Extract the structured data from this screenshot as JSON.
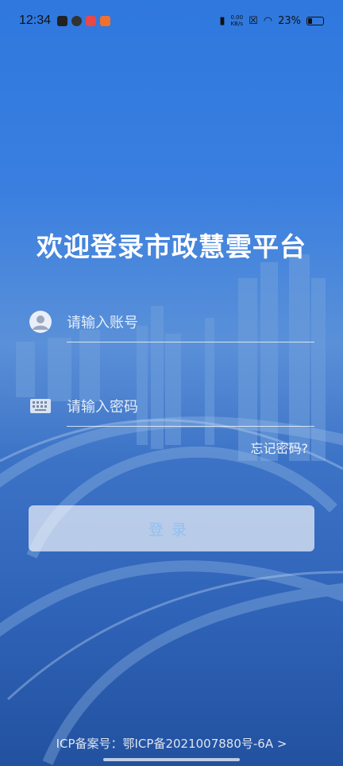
{
  "status_bar": {
    "time": "12:34",
    "net_speed_value": "0.00",
    "net_speed_unit": "KB/s",
    "battery_percent": "23%",
    "battery_level": 0.23
  },
  "app": {
    "title": "欢迎登录市政慧雲平台"
  },
  "form": {
    "account_placeholder": "请输入账号",
    "password_placeholder": "请输入密码",
    "forgot_label": "忘记密码?",
    "login_label": "登录"
  },
  "footer": {
    "icp_text": "ICP备案号：鄂ICP备2021007880号-6A >"
  },
  "colors": {
    "background": "#2f78de",
    "button_text": "#8fc1ee"
  }
}
